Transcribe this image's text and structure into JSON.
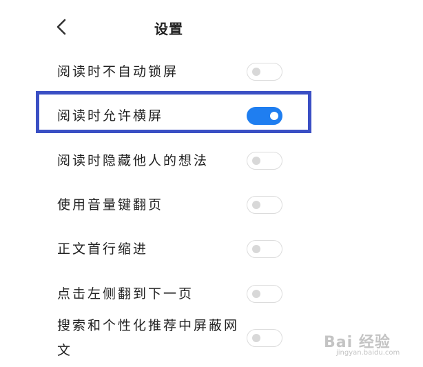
{
  "header": {
    "title": "设置",
    "back_icon": "chevron-left-icon"
  },
  "settings": [
    {
      "label": "阅读时不自动锁屏",
      "enabled": false
    },
    {
      "label": "阅读时允许横屏",
      "enabled": true
    },
    {
      "label": "阅读时隐藏他人的想法",
      "enabled": false
    },
    {
      "label": "使用音量键翻页",
      "enabled": false
    },
    {
      "label": "正文首行缩进",
      "enabled": false
    },
    {
      "label": "点击左侧翻到下一页",
      "enabled": false
    },
    {
      "label_line1": "搜索和个性化推荐中屏蔽网",
      "label_line2": "文",
      "enabled": false
    }
  ],
  "colors": {
    "toggle_on": "#1f7ef0",
    "toggle_off_border": "#dcdcdc",
    "highlight_border": "#3a4fc4"
  },
  "watermark": {
    "main": "Bai 经验",
    "sub": "jingyan.baidu.com"
  }
}
